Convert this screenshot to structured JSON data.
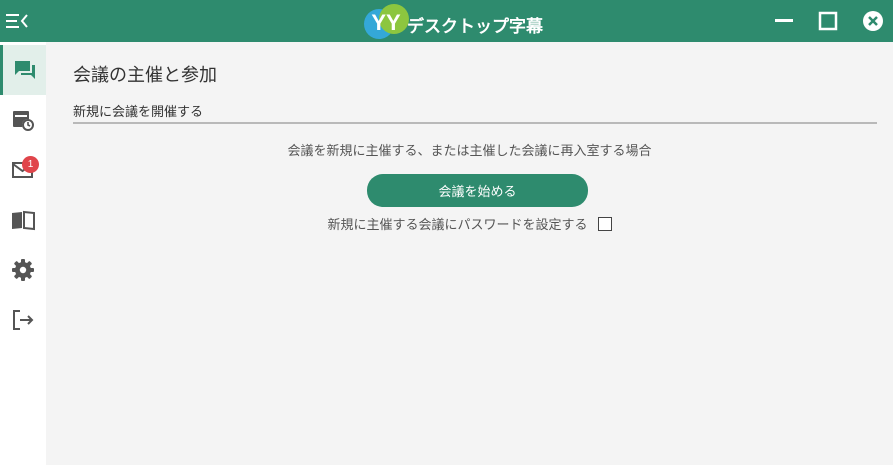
{
  "app": {
    "title": "デスクトップ字幕",
    "logo_text": "YY"
  },
  "colors": {
    "accent": "#2e8b6e",
    "badge": "#e0454b"
  },
  "sidebar": {
    "items": [
      {
        "icon": "chat-icon",
        "active": true
      },
      {
        "icon": "calendar-clock-icon",
        "active": false
      },
      {
        "icon": "mail-icon",
        "active": false,
        "badge": "1"
      },
      {
        "icon": "book-icon",
        "active": false
      },
      {
        "icon": "gear-icon",
        "active": false
      },
      {
        "icon": "logout-icon",
        "active": false
      }
    ]
  },
  "main": {
    "title": "会議の主催と参加",
    "tab_label": "新規に会議を開催する",
    "description": "会議を新規に主催する、または主催した会議に再入室する場合",
    "start_button": "会議を始める",
    "password_label": "新規に主催する会議にパスワードを設定する",
    "password_checked": false
  }
}
